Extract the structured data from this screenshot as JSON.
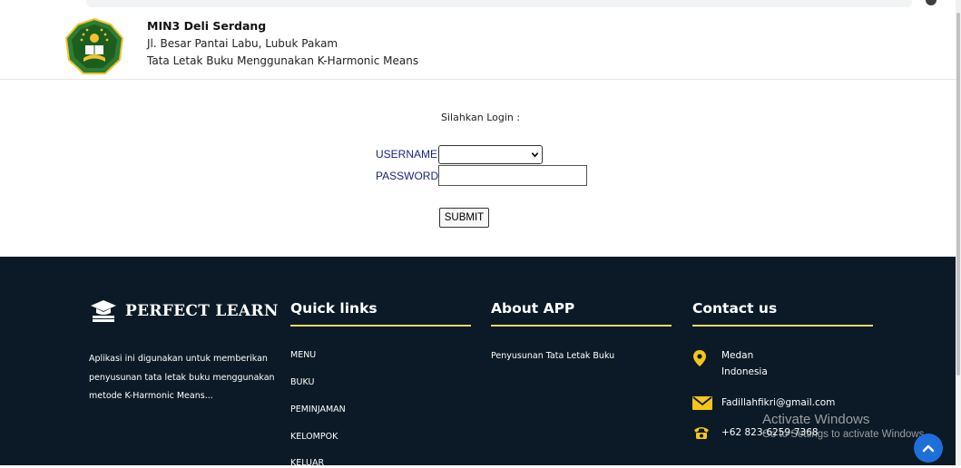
{
  "header": {
    "school_name": "MIN3 Deli Serdang",
    "address": "Jl. Besar Pantai Labu, Lubuk Pakam",
    "description": "Tata Letak Buku Menggunakan K-Harmonic Means"
  },
  "login": {
    "prompt": "Silahkan Login :",
    "username_label": "USERNAME",
    "password_label": "PASSWORD",
    "username_selected": "",
    "password_value": "",
    "submit_label": "SUBMIT"
  },
  "footer": {
    "brand": "PERFECT LEARN",
    "about_text": "Aplikasi ini digunakan untuk memberikan penyusunan tata letak buku menggunakan metode K-Harmonic Means...",
    "quick_links_title": "Quick links",
    "quick_links": [
      "MENU",
      "BUKU",
      "PEMINJAMAN",
      "KELOMPOK",
      "KELUAR"
    ],
    "about_title": "About APP",
    "about_item": "Penyusunan Tata Letak Buku",
    "contact_title": "Contact us",
    "contact": {
      "city": "Medan",
      "country": "Indonesia",
      "email": "Fadillahfikri@gmail.com",
      "phone": "+62 823-6259-7368"
    },
    "accent_color": "#f5d76e",
    "background_color": "#0b1a26"
  },
  "watermark": {
    "title": "Activate Windows",
    "subtitle": "Go to Settings to activate Windows."
  },
  "icons": {
    "logo": "kemenag-logo",
    "brand": "graduation-cap-book-icon",
    "location": "location-pin-icon",
    "email": "envelope-icon",
    "phone": "telephone-icon",
    "scroll_top": "chevron-up-icon"
  }
}
